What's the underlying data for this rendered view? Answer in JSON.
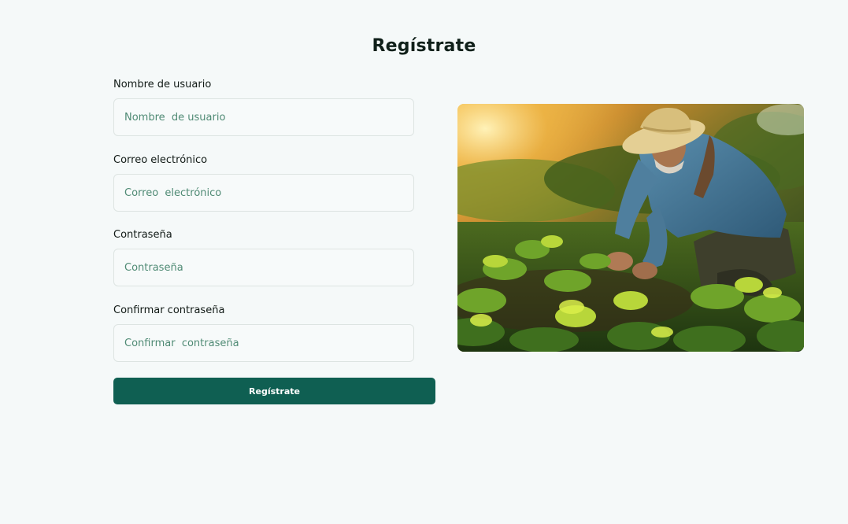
{
  "page": {
    "title": "Regístrate"
  },
  "form": {
    "fields": [
      {
        "label": "Nombre de usuario",
        "placeholder": "Nombre  de usuario",
        "value": ""
      },
      {
        "label": "Correo electrónico",
        "placeholder": "Correo  electrónico",
        "value": ""
      },
      {
        "label": "Contraseña",
        "placeholder": "Contraseña",
        "value": ""
      },
      {
        "label": "Confirmar contraseña",
        "placeholder": "Confirmar  contraseña",
        "value": ""
      }
    ],
    "submit_label": "Regístrate"
  },
  "image": {
    "subject": "farmer-tending-crops-photo"
  },
  "colors": {
    "background": "#f5f9f9",
    "accent": "#0f5f52",
    "placeholder": "#4f8a74",
    "input_border": "#dde4e2"
  }
}
